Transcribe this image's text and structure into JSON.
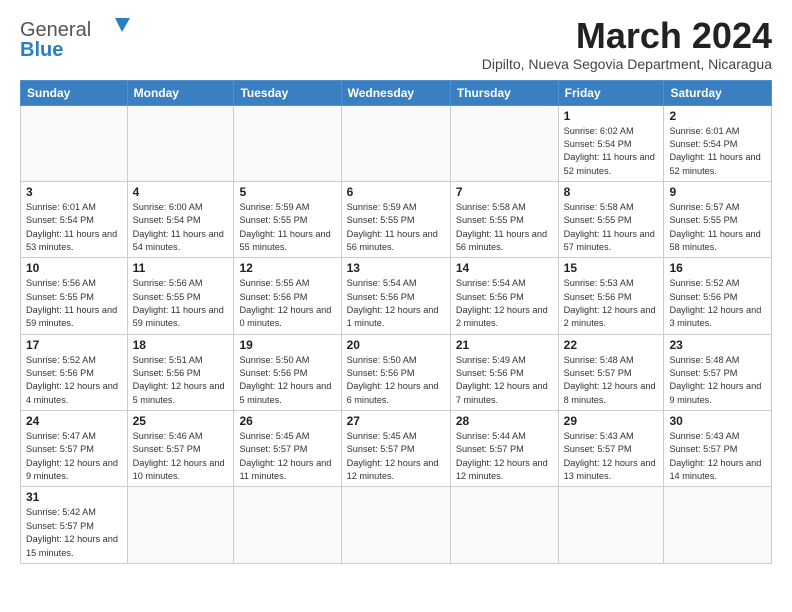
{
  "header": {
    "logo_general": "General",
    "logo_blue": "Blue",
    "month_title": "March 2024",
    "subtitle": "Dipilto, Nueva Segovia Department, Nicaragua"
  },
  "days_of_week": [
    "Sunday",
    "Monday",
    "Tuesday",
    "Wednesday",
    "Thursday",
    "Friday",
    "Saturday"
  ],
  "weeks": [
    [
      {
        "day": "",
        "info": ""
      },
      {
        "day": "",
        "info": ""
      },
      {
        "day": "",
        "info": ""
      },
      {
        "day": "",
        "info": ""
      },
      {
        "day": "",
        "info": ""
      },
      {
        "day": "1",
        "info": "Sunrise: 6:02 AM\nSunset: 5:54 PM\nDaylight: 11 hours and 52 minutes."
      },
      {
        "day": "2",
        "info": "Sunrise: 6:01 AM\nSunset: 5:54 PM\nDaylight: 11 hours and 52 minutes."
      }
    ],
    [
      {
        "day": "3",
        "info": "Sunrise: 6:01 AM\nSunset: 5:54 PM\nDaylight: 11 hours and 53 minutes."
      },
      {
        "day": "4",
        "info": "Sunrise: 6:00 AM\nSunset: 5:54 PM\nDaylight: 11 hours and 54 minutes."
      },
      {
        "day": "5",
        "info": "Sunrise: 5:59 AM\nSunset: 5:55 PM\nDaylight: 11 hours and 55 minutes."
      },
      {
        "day": "6",
        "info": "Sunrise: 5:59 AM\nSunset: 5:55 PM\nDaylight: 11 hours and 56 minutes."
      },
      {
        "day": "7",
        "info": "Sunrise: 5:58 AM\nSunset: 5:55 PM\nDaylight: 11 hours and 56 minutes."
      },
      {
        "day": "8",
        "info": "Sunrise: 5:58 AM\nSunset: 5:55 PM\nDaylight: 11 hours and 57 minutes."
      },
      {
        "day": "9",
        "info": "Sunrise: 5:57 AM\nSunset: 5:55 PM\nDaylight: 11 hours and 58 minutes."
      }
    ],
    [
      {
        "day": "10",
        "info": "Sunrise: 5:56 AM\nSunset: 5:55 PM\nDaylight: 11 hours and 59 minutes."
      },
      {
        "day": "11",
        "info": "Sunrise: 5:56 AM\nSunset: 5:55 PM\nDaylight: 11 hours and 59 minutes."
      },
      {
        "day": "12",
        "info": "Sunrise: 5:55 AM\nSunset: 5:56 PM\nDaylight: 12 hours and 0 minutes."
      },
      {
        "day": "13",
        "info": "Sunrise: 5:54 AM\nSunset: 5:56 PM\nDaylight: 12 hours and 1 minute."
      },
      {
        "day": "14",
        "info": "Sunrise: 5:54 AM\nSunset: 5:56 PM\nDaylight: 12 hours and 2 minutes."
      },
      {
        "day": "15",
        "info": "Sunrise: 5:53 AM\nSunset: 5:56 PM\nDaylight: 12 hours and 2 minutes."
      },
      {
        "day": "16",
        "info": "Sunrise: 5:52 AM\nSunset: 5:56 PM\nDaylight: 12 hours and 3 minutes."
      }
    ],
    [
      {
        "day": "17",
        "info": "Sunrise: 5:52 AM\nSunset: 5:56 PM\nDaylight: 12 hours and 4 minutes."
      },
      {
        "day": "18",
        "info": "Sunrise: 5:51 AM\nSunset: 5:56 PM\nDaylight: 12 hours and 5 minutes."
      },
      {
        "day": "19",
        "info": "Sunrise: 5:50 AM\nSunset: 5:56 PM\nDaylight: 12 hours and 5 minutes."
      },
      {
        "day": "20",
        "info": "Sunrise: 5:50 AM\nSunset: 5:56 PM\nDaylight: 12 hours and 6 minutes."
      },
      {
        "day": "21",
        "info": "Sunrise: 5:49 AM\nSunset: 5:56 PM\nDaylight: 12 hours and 7 minutes."
      },
      {
        "day": "22",
        "info": "Sunrise: 5:48 AM\nSunset: 5:57 PM\nDaylight: 12 hours and 8 minutes."
      },
      {
        "day": "23",
        "info": "Sunrise: 5:48 AM\nSunset: 5:57 PM\nDaylight: 12 hours and 9 minutes."
      }
    ],
    [
      {
        "day": "24",
        "info": "Sunrise: 5:47 AM\nSunset: 5:57 PM\nDaylight: 12 hours and 9 minutes."
      },
      {
        "day": "25",
        "info": "Sunrise: 5:46 AM\nSunset: 5:57 PM\nDaylight: 12 hours and 10 minutes."
      },
      {
        "day": "26",
        "info": "Sunrise: 5:45 AM\nSunset: 5:57 PM\nDaylight: 12 hours and 11 minutes."
      },
      {
        "day": "27",
        "info": "Sunrise: 5:45 AM\nSunset: 5:57 PM\nDaylight: 12 hours and 12 minutes."
      },
      {
        "day": "28",
        "info": "Sunrise: 5:44 AM\nSunset: 5:57 PM\nDaylight: 12 hours and 12 minutes."
      },
      {
        "day": "29",
        "info": "Sunrise: 5:43 AM\nSunset: 5:57 PM\nDaylight: 12 hours and 13 minutes."
      },
      {
        "day": "30",
        "info": "Sunrise: 5:43 AM\nSunset: 5:57 PM\nDaylight: 12 hours and 14 minutes."
      }
    ],
    [
      {
        "day": "31",
        "info": "Sunrise: 5:42 AM\nSunset: 5:57 PM\nDaylight: 12 hours and 15 minutes."
      },
      {
        "day": "",
        "info": ""
      },
      {
        "day": "",
        "info": ""
      },
      {
        "day": "",
        "info": ""
      },
      {
        "day": "",
        "info": ""
      },
      {
        "day": "",
        "info": ""
      },
      {
        "day": "",
        "info": ""
      }
    ]
  ]
}
